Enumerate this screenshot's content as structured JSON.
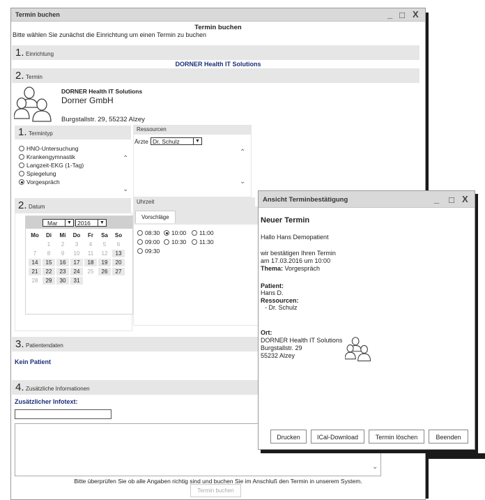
{
  "window": {
    "title": "Termin buchen"
  },
  "header": {
    "heading": "Termin buchen",
    "intro": "Bitte wählen Sie zunächst die Einrichtung um einen Termin zu buchen"
  },
  "sections": {
    "einrichtung": {
      "num": "1.",
      "label": "Einrichtung",
      "value": "DORNER Health IT Solutions"
    },
    "termin": {
      "num": "2.",
      "label": "Termin"
    },
    "patientendaten": {
      "num": "3.",
      "label": "Patientendaten",
      "value": "Kein Patient"
    },
    "zusatz": {
      "num": "4.",
      "label": "Zusätzliche Informationen",
      "infotext_label": "Zusätzlicher Infotext:"
    }
  },
  "facility": {
    "name_bold": "DORNER Health IT Solutions",
    "name": "Dorner GmbH",
    "address": "Burgstallstr. 29, 55232 Alzey"
  },
  "termintyp": {
    "num": "1.",
    "label": "Termintyp",
    "options": [
      {
        "label": "HNO-Untersuchung",
        "selected": false
      },
      {
        "label": "Krankengymnastik",
        "selected": false
      },
      {
        "label": "Langzeit-EKG (1-Tag)",
        "selected": false
      },
      {
        "label": "Spiegelung",
        "selected": false
      },
      {
        "label": "Vorgespräch",
        "selected": true
      }
    ]
  },
  "ressourcen": {
    "label": "Ressourcen",
    "field_label": "Ärzte",
    "selected": "Dr. Schulz"
  },
  "datum": {
    "num": "2.",
    "label": "Datum",
    "month": "Mar",
    "year": "2016",
    "weekdays": [
      "Mo",
      "Di",
      "Mi",
      "Do",
      "Fr",
      "Sa",
      "So"
    ],
    "weeks": [
      [
        "",
        "1",
        "2",
        "3",
        "4",
        "5",
        "6"
      ],
      [
        "7",
        "8",
        "9",
        "10",
        "11",
        "12",
        "13"
      ],
      [
        "14",
        "15",
        "16",
        "17",
        "18",
        "19",
        "20"
      ],
      [
        "21",
        "22",
        "23",
        "24",
        "25",
        "26",
        "27"
      ],
      [
        "28",
        "29",
        "30",
        "31",
        "",
        "",
        ""
      ]
    ],
    "available": [
      "13",
      "14",
      "15",
      "16",
      "17",
      "18",
      "19",
      "20",
      "21",
      "22",
      "23",
      "24",
      "26",
      "27",
      "29",
      "30",
      "31"
    ]
  },
  "uhrzeit": {
    "label": "Uhrzeit",
    "tab": "Vorschläge",
    "slots": [
      {
        "label": "08:30",
        "selected": false
      },
      {
        "label": "10:00",
        "selected": true
      },
      {
        "label": "11:00",
        "selected": false
      },
      {
        "label": "09:00",
        "selected": false
      },
      {
        "label": "10:30",
        "selected": false
      },
      {
        "label": "11:30",
        "selected": false
      },
      {
        "label": "09:30",
        "selected": false
      }
    ]
  },
  "footer": {
    "note": "Bitte überprüfen Sie ob alle Angaben richtig sind und buchen Sie im Anschluß den Termin in unserem System.",
    "book_button": "Termin buchen"
  },
  "dialog": {
    "title": "Ansicht Terminbestätigung",
    "heading": "Neuer Termin",
    "greeting": "Hallo Hans Demopatient",
    "confirm1": "wir bestätigen Ihren Termin",
    "confirm2": "am 17.03.2016 um 10:00",
    "thema_label": "Thema:",
    "thema_value": "Vorgespräch",
    "patient_label": "Patient:",
    "patient_value": "Hans D.",
    "ressourcen_label": "Ressourcen:",
    "ressourcen_value": "- Dr. Schulz",
    "ort_label": "Ort:",
    "ort_line1": "DORNER Health IT Solutions",
    "ort_line2": "Burgstallstr. 29",
    "ort_line3": "55232 Alzey",
    "buttons": {
      "print": "Drucken",
      "ical": "ICal-Download",
      "delete": "Termin löschen",
      "close": "Beenden"
    }
  },
  "window_controls": {
    "minimize": "_",
    "maximize": "□",
    "close": "X"
  }
}
